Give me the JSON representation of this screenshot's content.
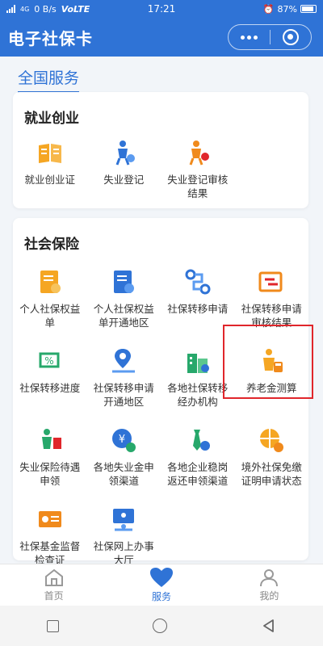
{
  "status_bar": {
    "network": "4G",
    "speed": "0 B/s",
    "volte": "VoLTE",
    "time": "17:21",
    "battery": "87%"
  },
  "header": {
    "title": "电子社保卡"
  },
  "section_title": "全国服务",
  "employment": {
    "title": "就业创业",
    "items": [
      {
        "label": "就业创业证",
        "icon": "employment-certificate-icon"
      },
      {
        "label": "失业登记",
        "icon": "unemployment-registration-icon"
      },
      {
        "label": "失业登记审核结果",
        "icon": "registration-review-icon"
      }
    ]
  },
  "social_insurance": {
    "title": "社会保险",
    "items": [
      {
        "label": "个人社保权益单",
        "icon": "rights-record-icon"
      },
      {
        "label": "个人社保权益单开通地区",
        "icon": "rights-region-icon"
      },
      {
        "label": "社保转移申请",
        "icon": "transfer-route-icon"
      },
      {
        "label": "社保转移申请审核结果",
        "icon": "transfer-result-icon"
      },
      {
        "label": "社保转移进度",
        "icon": "transfer-progress-icon"
      },
      {
        "label": "社保转移申请开通地区",
        "icon": "transfer-region-icon"
      },
      {
        "label": "各地社保转移经办机构",
        "icon": "agency-building-icon"
      },
      {
        "label": "养老金测算",
        "icon": "pension-calc-icon"
      },
      {
        "label": "失业保险待遇申领",
        "icon": "unemployment-benefit-icon"
      },
      {
        "label": "各地失业金申领渠道",
        "icon": "unemployment-channel-icon"
      },
      {
        "label": "各地企业稳岗返还申领渠道",
        "icon": "job-stability-icon"
      },
      {
        "label": "境外社保免缴证明申请状态",
        "icon": "overseas-exemption-icon"
      },
      {
        "label": "社保基金监督检查证",
        "icon": "fund-supervision-icon"
      },
      {
        "label": "社保网上办事大厅",
        "icon": "online-hall-icon"
      }
    ]
  },
  "tab_bar": {
    "tabs": [
      {
        "label": "首页",
        "icon": "home-icon"
      },
      {
        "label": "服务",
        "icon": "heart-icon"
      },
      {
        "label": "我的",
        "icon": "profile-icon"
      }
    ]
  },
  "colors": {
    "primary": "#2f73d6",
    "accent_orange": "#f5a623",
    "accent_green": "#27a86b",
    "highlight_red": "#e0262b"
  }
}
